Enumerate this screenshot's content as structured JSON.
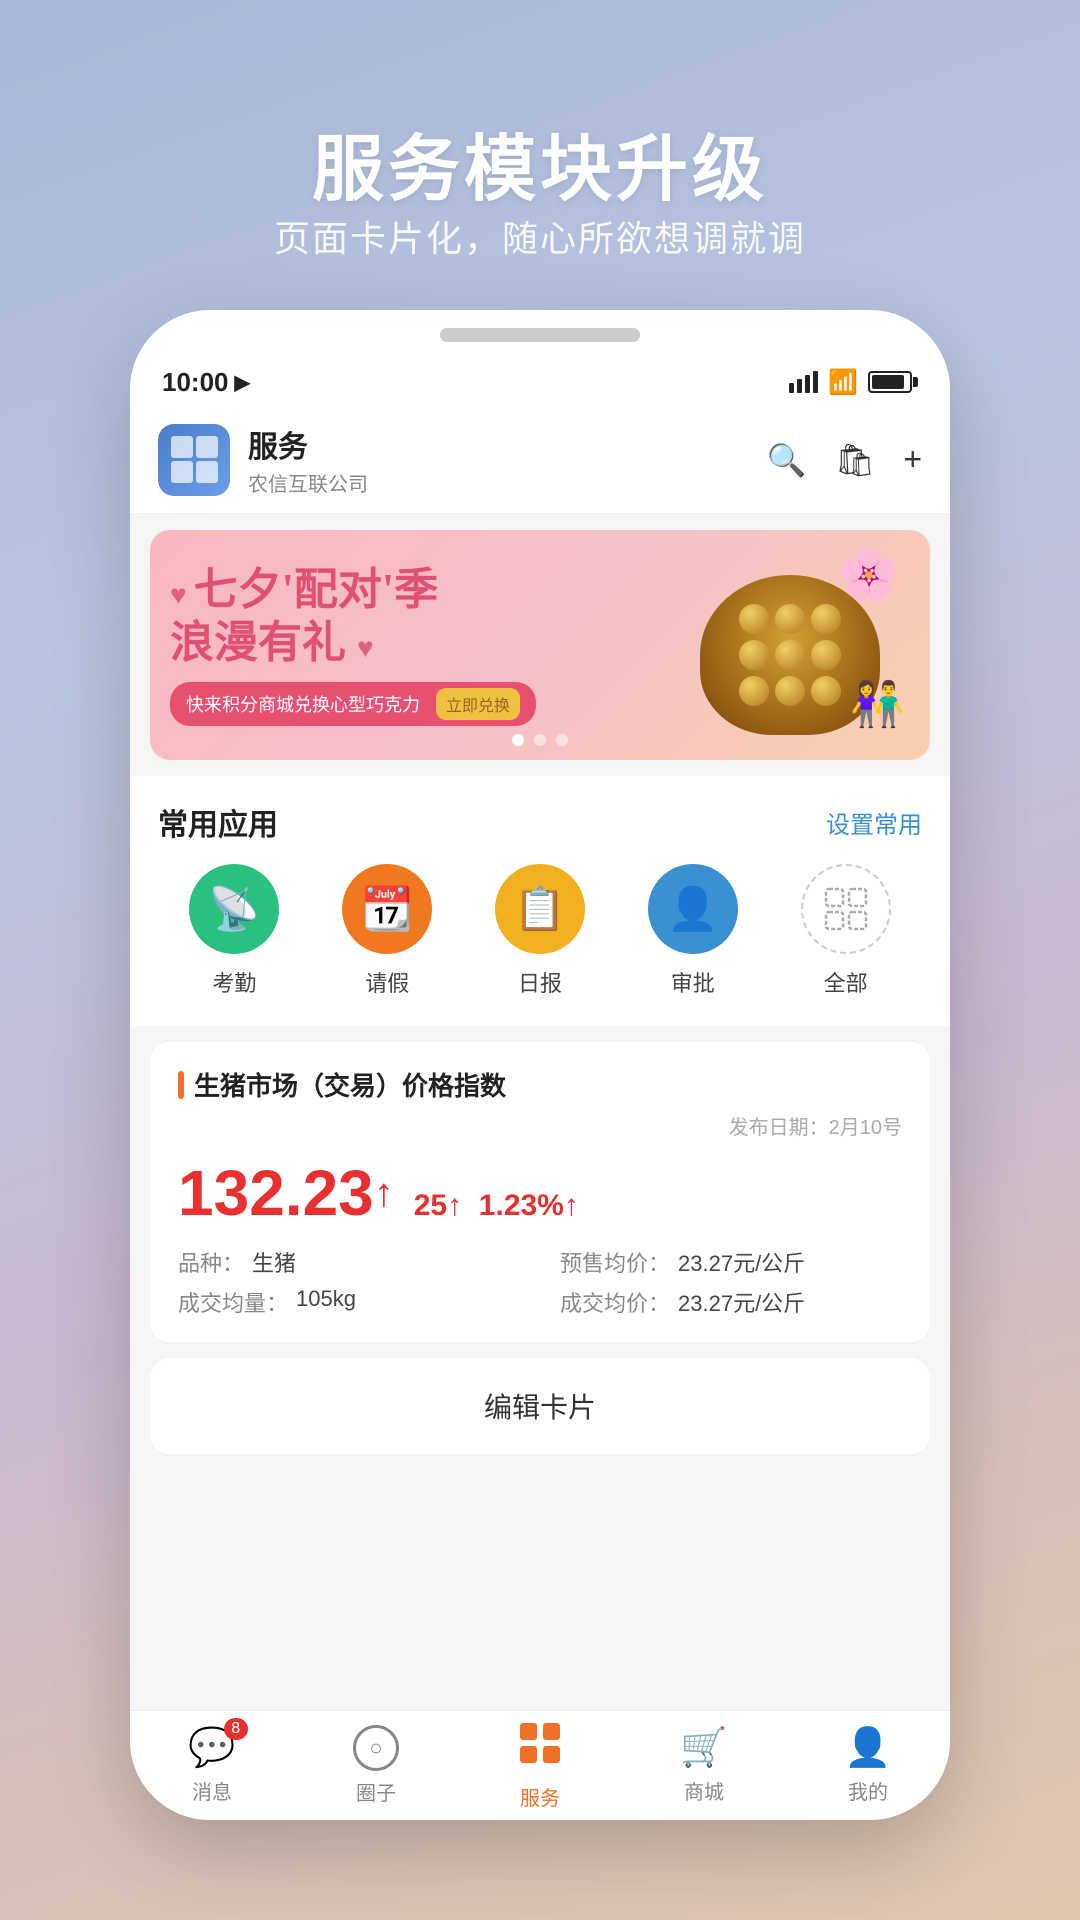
{
  "page": {
    "bg_title": "服务模块升级",
    "bg_subtitle": "页面卡片化，随心所欲想调就调"
  },
  "phone": {
    "status_bar": {
      "time": "10:00",
      "location_icon": "▶"
    },
    "header": {
      "app_name": "服务",
      "app_company": "农信互联公司",
      "search_icon": "search",
      "bag_icon": "bag",
      "add_icon": "plus"
    },
    "banner": {
      "title_line1": "七夕'配对'季",
      "title_line2": "浪漫有礼",
      "hearts": "♥",
      "sub_text": "快来积分商城兑换心型巧克力",
      "exchange_btn": "立即兑换",
      "dots": [
        true,
        false,
        false
      ]
    },
    "common_apps": {
      "section_title": "常用应用",
      "action_label": "设置常用",
      "items": [
        {
          "id": "kaoqin",
          "label": "考勤",
          "icon": "⚡",
          "color": "green"
        },
        {
          "id": "qingjia",
          "label": "请假",
          "icon": "📅",
          "color": "orange"
        },
        {
          "id": "ribao",
          "label": "日报",
          "icon": "📋",
          "color": "yellow"
        },
        {
          "id": "shenpi",
          "label": "审批",
          "icon": "👤",
          "color": "blue"
        },
        {
          "id": "quanbu",
          "label": "全部",
          "icon": "⊞",
          "color": "outline"
        }
      ]
    },
    "price_index": {
      "title": "生猪市场（交易）价格指数",
      "date_label": "发布日期：",
      "date_value": "2月10号",
      "main_value": "132.23",
      "up_arrow": "↑",
      "change1": "25↑",
      "change2": "1.23%↑",
      "details": [
        {
          "label": "品种：",
          "value": "生猪"
        },
        {
          "label": "预售均价：",
          "value": "23.27元/公斤"
        },
        {
          "label": "成交均量：",
          "value": "105kg"
        },
        {
          "label": "成交均价：",
          "value": "23.27元/公斤"
        }
      ]
    },
    "edit_card_btn": "编辑卡片",
    "tab_bar": {
      "items": [
        {
          "id": "messages",
          "label": "消息",
          "icon": "💬",
          "badge": "8",
          "active": false
        },
        {
          "id": "circle",
          "label": "圈子",
          "icon": "⊙",
          "active": false
        },
        {
          "id": "service",
          "label": "服务",
          "icon": "⊞",
          "active": true
        },
        {
          "id": "mall",
          "label": "商城",
          "icon": "🛒",
          "active": false
        },
        {
          "id": "mine",
          "label": "我的",
          "icon": "👤",
          "active": false
        }
      ]
    }
  }
}
